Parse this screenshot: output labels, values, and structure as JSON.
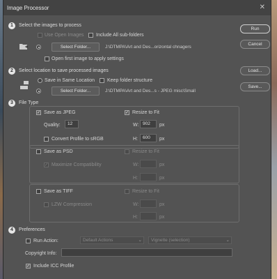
{
  "title": "Image Processor",
  "sections": {
    "s1": {
      "number": "1",
      "heading": "Select the images to process",
      "use_open_images": "Use Open Images",
      "include_subfolders": "Include All sub-folders",
      "select_folder": "Select Folder...",
      "path": "J:\\DTMPA\\Art and Des...orizontal  chnagers",
      "open_first": "Open first image to apply settings"
    },
    "s2": {
      "number": "2",
      "heading": "Select location to save processed images",
      "same_location": "Save in Same Location",
      "keep_structure": "Keep folder structure",
      "select_folder": "Select Folder...",
      "path": "J:\\DTMPA\\Art and Des...s - JPEG misc\\Small"
    },
    "s3": {
      "number": "3",
      "heading": "File Type",
      "save_jpeg": "Save as JPEG",
      "resize_jpeg": "Resize to Fit",
      "quality_label": "Quality:",
      "quality_value": "12",
      "w_label": "W:",
      "w_value": "902",
      "h_label": "H:",
      "h_value": "600",
      "unit": "px",
      "convert_srgb": "Convert Profile to sRGB",
      "save_psd": "Save as PSD",
      "resize_psd": "Resize to Fit",
      "max_compat": "Maximize Compatibility",
      "save_tiff": "Save as TIFF",
      "resize_tiff": "Resize to Fit",
      "lzw": "LZW Compression"
    },
    "s4": {
      "number": "4",
      "heading": "Preferences",
      "run_action": "Run Action:",
      "action_set": "Default Actions",
      "action": "Vignette (selection)",
      "copyright": "Copyright Info:",
      "include_icc": "Include ICC Profile"
    }
  },
  "buttons": {
    "run": "Run",
    "cancel": "Cancel",
    "load": "Load...",
    "save": "Save..."
  },
  "checkmark": "✓"
}
